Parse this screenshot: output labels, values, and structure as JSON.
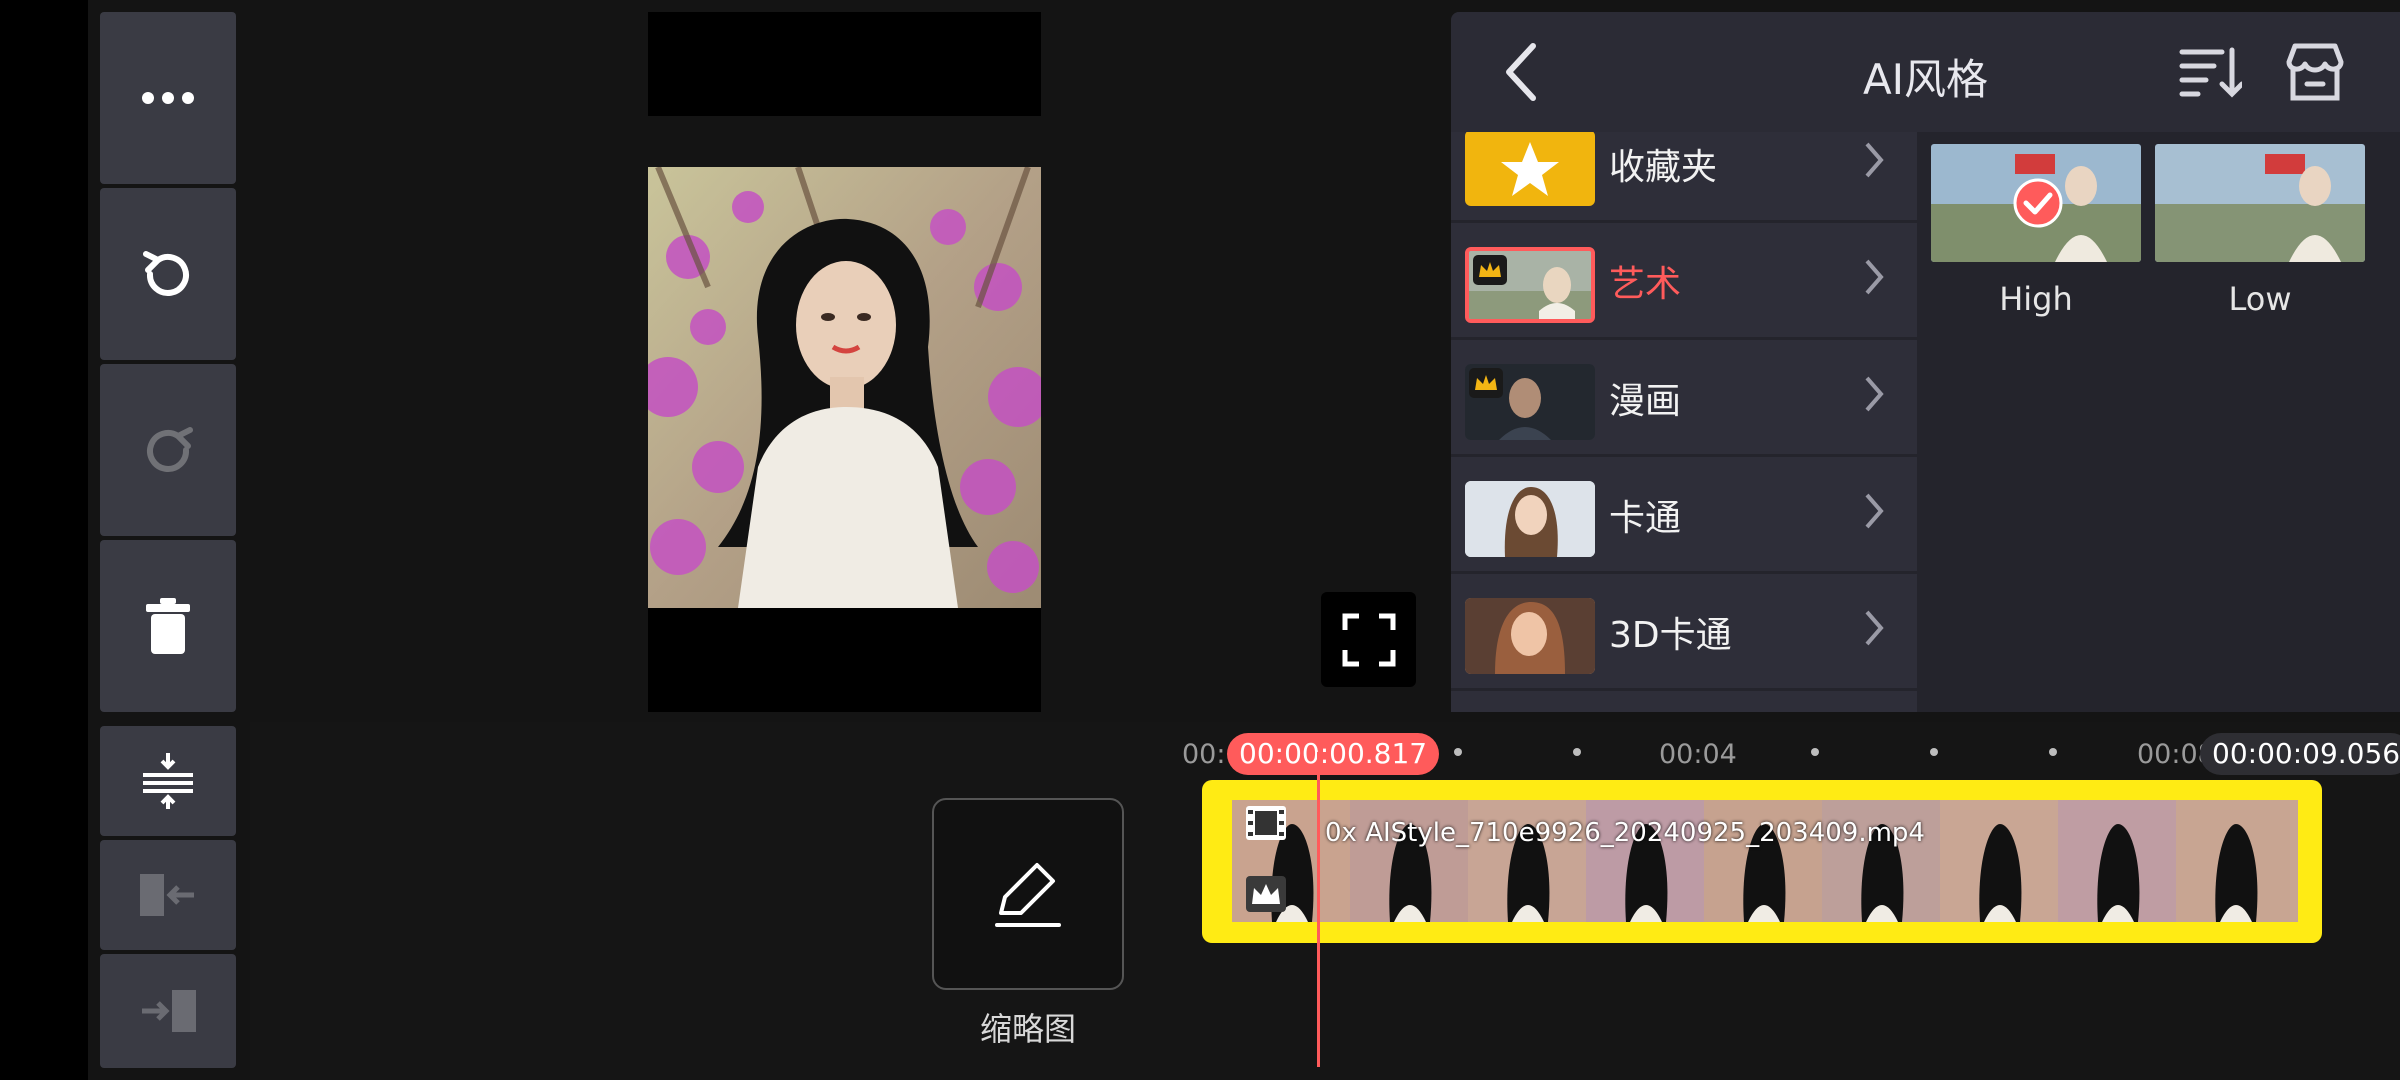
{
  "panel": {
    "title": "AI风格"
  },
  "categories": [
    {
      "label": "收藏夹",
      "selected": false
    },
    {
      "label": "艺术",
      "selected": true
    },
    {
      "label": "漫画",
      "selected": false
    },
    {
      "label": "卡通",
      "selected": false
    },
    {
      "label": "3D卡通",
      "selected": false
    }
  ],
  "styles": [
    {
      "label": "High",
      "selected": true
    },
    {
      "label": "Low",
      "selected": false
    }
  ],
  "timeline": {
    "ruler_start": "00:",
    "ruler_mid": "00:04",
    "ruler_end": "00:08",
    "current_time": "00:00:00.817",
    "total_time": "00:00:09.056",
    "clip_name": "0x AIStyle_710e9926_20240925_203409.mp4"
  },
  "thumbnail": {
    "label": "缩略图"
  },
  "colors": {
    "accent_red": "#ff5b5b",
    "clip_yellow": "#ffeb14",
    "panel_bg": "#24242c"
  },
  "icons": {
    "more": "more-icon",
    "undo": "undo-icon",
    "redo": "redo-icon",
    "delete": "trash-icon",
    "fullscreen": "fullscreen-icon",
    "back": "back-icon",
    "sort": "sort-icon",
    "store": "store-icon",
    "edit": "pencil-icon"
  }
}
